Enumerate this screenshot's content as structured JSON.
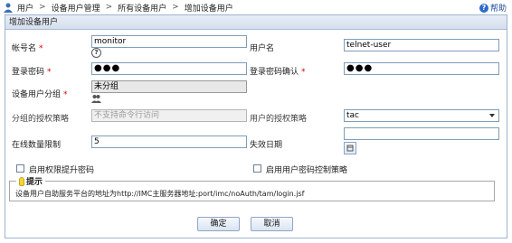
{
  "breadcrumb": {
    "items": [
      "用户",
      "设备用户管理",
      "所有设备用户",
      "增加设备用户"
    ],
    "separator": ">"
  },
  "help": {
    "label": "帮助"
  },
  "panel": {
    "title": "增加设备用户"
  },
  "form": {
    "account_name": {
      "label": "帐号名",
      "value": "monitor"
    },
    "user_name": {
      "label": "用户名",
      "value": "telnet-user"
    },
    "password": {
      "label": "登录密码",
      "value": "●●●"
    },
    "password_confirm": {
      "label": "登录密码确认",
      "value": "●●●"
    },
    "user_group": {
      "label": "设备用户分组",
      "value": "未分组"
    },
    "group_auth_policy": {
      "label": "分组的授权策略",
      "value": "不支持命令行访问"
    },
    "user_auth_policy": {
      "label": "用户的授权策略",
      "value": "tac"
    },
    "online_limit": {
      "label": "在线数量限制",
      "value": "5"
    },
    "expire_date": {
      "label": "失效日期",
      "value": ""
    },
    "enable_priv_password": {
      "label": "启用权限提升密码",
      "checked": false
    },
    "enable_password_policy": {
      "label": "启用用户密码控制策略",
      "checked": false
    },
    "required_mark": "*"
  },
  "tip": {
    "title": "提示",
    "text": "设备用户自助服务平台的地址为http://IMC主服务器地址:port/imc/noAuth/tam/login.jsf"
  },
  "buttons": {
    "ok": "确定",
    "cancel": "取消"
  },
  "colors": {
    "header_bg": "#d4dfed",
    "border": "#9fb4cf",
    "required": "#dd0000",
    "link": "#1f4e9a"
  }
}
